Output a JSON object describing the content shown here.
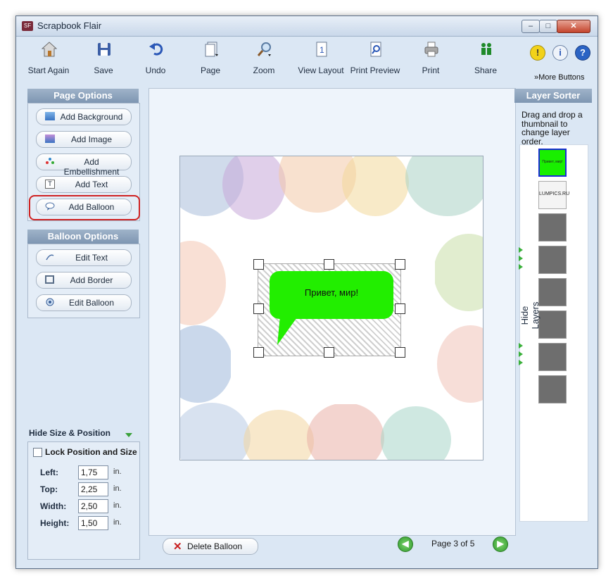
{
  "window": {
    "title": "Scrapbook Flair",
    "app_icon_text": "SF",
    "controls": {
      "minimize": "–",
      "maximize": "□",
      "close": "✕"
    }
  },
  "toolbar": {
    "items": [
      {
        "label": "Start Again",
        "icon": "house-icon"
      },
      {
        "label": "Save",
        "icon": "floppy-disk-icon"
      },
      {
        "label": "Undo",
        "icon": "undo-arrow-icon"
      },
      {
        "label": "Page",
        "icon": "page-icon"
      },
      {
        "label": "Zoom",
        "icon": "magnifier-icon"
      },
      {
        "label": "View Layout",
        "icon": "layout-icon"
      },
      {
        "label": "Print Preview",
        "icon": "print-preview-icon"
      },
      {
        "label": "Print",
        "icon": "printer-icon"
      },
      {
        "label": "Share",
        "icon": "people-icon"
      }
    ],
    "help_buttons": [
      {
        "glyph": "!",
        "icon": "tip-icon",
        "color": "#f2d21a"
      },
      {
        "glyph": "i",
        "icon": "info-icon",
        "color": "#3d74c8"
      },
      {
        "glyph": "?",
        "icon": "help-icon",
        "color": "#2a63c4"
      }
    ],
    "more_buttons": "»More Buttons"
  },
  "page_options": {
    "title": "Page Options",
    "buttons": [
      {
        "label": "Add Background",
        "icon": "background-icon"
      },
      {
        "label": "Add Image",
        "icon": "image-icon"
      },
      {
        "label": "Add Embellishment",
        "icon": "embellishment-icon"
      },
      {
        "label": "Add Text",
        "icon": "text-icon"
      },
      {
        "label": "Add Balloon",
        "icon": "balloon-icon"
      }
    ]
  },
  "balloon_options": {
    "title": "Balloon Options",
    "buttons": [
      {
        "label": "Edit Text",
        "icon": "edit-text-icon"
      },
      {
        "label": "Add Border",
        "icon": "border-icon"
      },
      {
        "label": "Edit Balloon",
        "icon": "edit-balloon-icon"
      }
    ]
  },
  "size_position": {
    "toggle_label": "Hide Size & Position",
    "lock_label": "Lock Position and Size",
    "lock_checked": false,
    "unit": "in.",
    "fields": [
      {
        "label": "Left:",
        "value": "1,75"
      },
      {
        "label": "Top:",
        "value": "2,25"
      },
      {
        "label": "Width:",
        "value": "2,50"
      },
      {
        "label": "Height:",
        "value": "1,50"
      }
    ]
  },
  "canvas": {
    "balloon_text": "Привет, мир!",
    "balloon_color": "#22ee00"
  },
  "bottom": {
    "delete_label": "Delete Balloon",
    "page_indicator": "Page 3 of 5"
  },
  "layer_sorter": {
    "title": "Layer Sorter",
    "help": "Drag and drop a thumbnail to change layer order.",
    "hide_label": "Hide Layers",
    "thumb_1_text": "Привет, мир!",
    "thumb_2_text": "LUMPICS.RU"
  }
}
